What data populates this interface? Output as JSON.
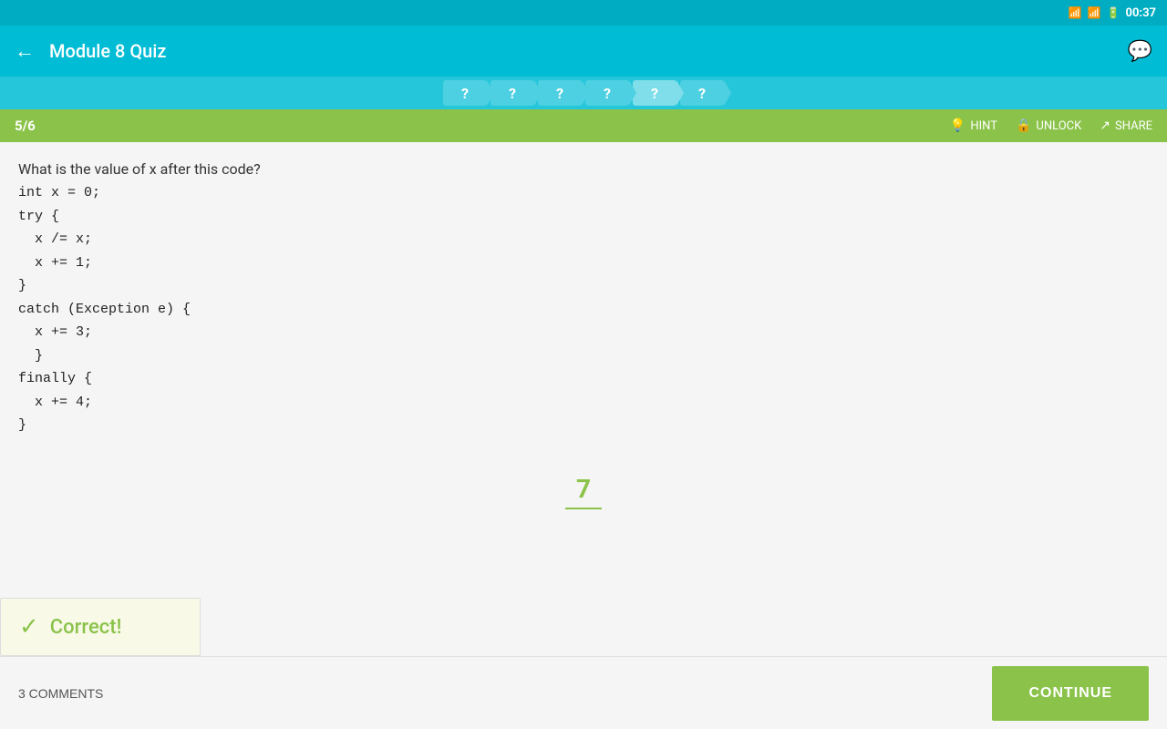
{
  "statusBar": {
    "wifi": "▲",
    "signal": "▲",
    "battery": "▮",
    "time": "00:37"
  },
  "topBar": {
    "title": "Module 8 Quiz",
    "backIcon": "←",
    "chatIcon": "💬"
  },
  "progressBar": {
    "items": [
      {
        "label": "?",
        "active": false
      },
      {
        "label": "?",
        "active": false
      },
      {
        "label": "?",
        "active": false
      },
      {
        "label": "?",
        "active": false
      },
      {
        "label": "?",
        "active": true
      },
      {
        "label": "?",
        "active": false
      }
    ]
  },
  "counterBar": {
    "counter": "5/6",
    "hint": "HINT",
    "unlock": "UNLOCK",
    "share": "SHARE"
  },
  "question": {
    "text": "What is the value of x after this code?",
    "code": "int x = 0;\ntry {\n  x /= x;\n  x += 1;\n}\ncatch (Exception e) {\n  x += 3;\n  }\nfinally {\n  x += 4;\n}"
  },
  "answer": {
    "value": "7"
  },
  "correctBanner": {
    "checkIcon": "✓",
    "text": "Correct!"
  },
  "bottomBar": {
    "commentsLabel": "3 COMMENTS",
    "continueLabel": "CONTINUE"
  }
}
